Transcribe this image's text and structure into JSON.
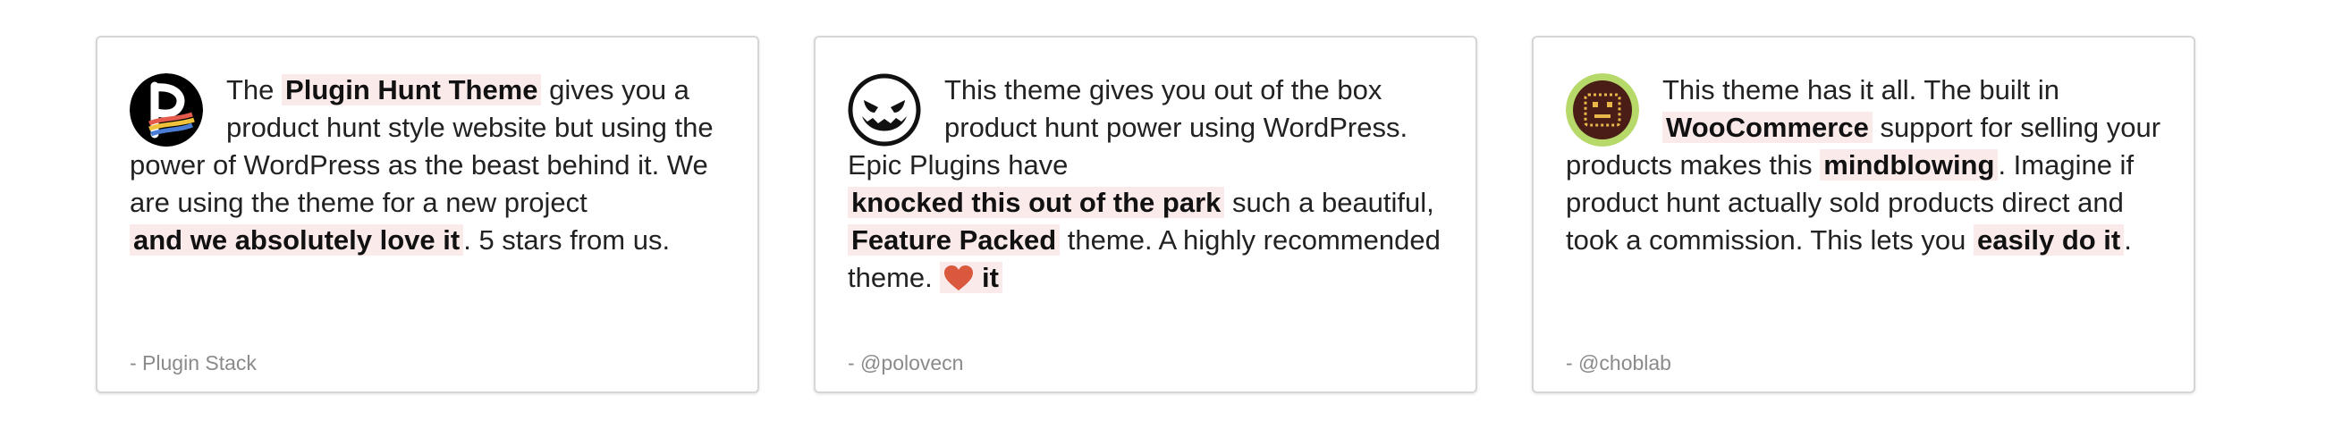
{
  "testimonials": [
    {
      "avatar_icon": "plugin-stack-logo-icon",
      "text_1": "The",
      "hl_1": "Plugin Hunt Theme",
      "text_2": "gives you a product hunt style website but using the power of WordPress as the beast behind it. We are using the theme for a new project",
      "hl_2": "and we absolutely love it",
      "text_3": ". 5 stars from us.",
      "author": "- Plugin Stack"
    },
    {
      "avatar_icon": "evil-smiley-icon",
      "text_1": "This theme gives you out of the box product hunt power using WordPress. Epic Plugins have",
      "hl_1": "knocked this out of the park",
      "text_2": "such a beautiful,",
      "hl_2": "Feature Packed",
      "text_3": "theme. A highly recommended theme.",
      "heart_icon": "heart-icon",
      "hl_3": "it",
      "author": "- @polovecn"
    },
    {
      "avatar_icon": "robot-face-icon",
      "text_1": "This theme has it all. The built in",
      "hl_1": "WooCommerce",
      "text_2": "support for selling your products makes this",
      "hl_2": "mindblowing",
      "text_3": ". Imagine if product hunt actually sold products direct and took a commission. This lets you",
      "hl_3": "easily do it",
      "text_4": ".",
      "author": "- @choblab"
    }
  ],
  "colors": {
    "highlight_bg": "#fbeaea",
    "heart": "#d9583e",
    "card_border": "#d6d6d6",
    "author_text": "#8a8a8a"
  }
}
